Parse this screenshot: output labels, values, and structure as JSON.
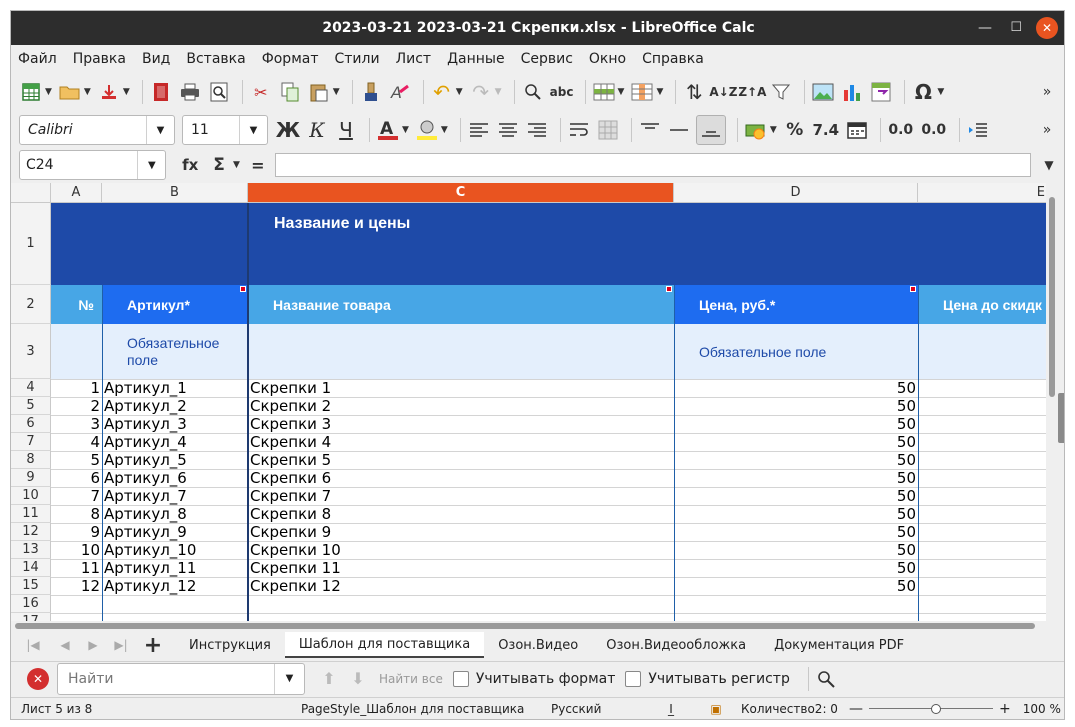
{
  "window": {
    "title": "2023-03-21 2023-03-21 Скрепки.xlsx - LibreOffice Calc"
  },
  "menu": [
    "Файл",
    "Правка",
    "Вид",
    "Вставка",
    "Формат",
    "Стили",
    "Лист",
    "Данные",
    "Сервис",
    "Окно",
    "Справка"
  ],
  "toolbar": {
    "font_name": "Calibri",
    "font_size": "11",
    "bold": "Ж",
    "italic": "К",
    "underline": "Ч",
    "currency_icon": "cash-icon",
    "percent": "%",
    "number_format": "7.4",
    "add_decimal": "0.0",
    "remove_decimal": "0.0"
  },
  "formula_bar": {
    "cell_ref": "C24",
    "fx": "fx",
    "sigma": "Σ",
    "equals": "=",
    "content": ""
  },
  "grid": {
    "columns": [
      "A",
      "B",
      "C",
      "D",
      "E"
    ],
    "active_column": "C",
    "row_numbers": [
      "1",
      "2",
      "3",
      "4",
      "5",
      "6",
      "7",
      "8",
      "9",
      "10",
      "11",
      "12",
      "13",
      "14",
      "15",
      "16",
      "17"
    ],
    "header_title": "Название и цены",
    "header_row": {
      "a": "№",
      "b": "Артикул*",
      "c": "Название товара",
      "d": "Цена, руб.*",
      "e": "Цена до скидк"
    },
    "hint_row": {
      "b": "Обязательное поле",
      "d": "Обязательное поле"
    },
    "rows": [
      {
        "n": "1",
        "sku": "Артикул_1",
        "name": "Скрепки 1",
        "price": "50"
      },
      {
        "n": "2",
        "sku": "Артикул_2",
        "name": "Скрепки 2",
        "price": "50"
      },
      {
        "n": "3",
        "sku": "Артикул_3",
        "name": "Скрепки 3",
        "price": "50"
      },
      {
        "n": "4",
        "sku": "Артикул_4",
        "name": "Скрепки 4",
        "price": "50"
      },
      {
        "n": "5",
        "sku": "Артикул_5",
        "name": "Скрепки 5",
        "price": "50"
      },
      {
        "n": "6",
        "sku": "Артикул_6",
        "name": "Скрепки 6",
        "price": "50"
      },
      {
        "n": "7",
        "sku": "Артикул_7",
        "name": "Скрепки 7",
        "price": "50"
      },
      {
        "n": "8",
        "sku": "Артикул_8",
        "name": "Скрепки 8",
        "price": "50"
      },
      {
        "n": "9",
        "sku": "Артикул_9",
        "name": "Скрепки 9",
        "price": "50"
      },
      {
        "n": "10",
        "sku": "Артикул_10",
        "name": "Скрепки 10",
        "price": "50"
      },
      {
        "n": "11",
        "sku": "Артикул_11",
        "name": "Скрепки 11",
        "price": "50"
      },
      {
        "n": "12",
        "sku": "Артикул_12",
        "name": "Скрепки 12",
        "price": "50"
      }
    ],
    "colors": {
      "title_bg": "#1e4aa8",
      "header_dark": "#1e6cf0",
      "header_light": "#47a6e6",
      "hint_bg": "#e4effc"
    }
  },
  "sheet_tabs": [
    "Инструкция",
    "Шаблон для поставщика",
    "Озон.Видео",
    "Озон.Видеообложка",
    "Документация PDF"
  ],
  "active_tab": "Шаблон для поставщика",
  "find": {
    "placeholder": "Найти",
    "find_all": "Найти все",
    "match_format": "Учитывать формат",
    "match_case": "Учитывать регистр"
  },
  "status": {
    "sheet": "Лист 5 из 8",
    "page_style": "PageStyle_Шаблон для поставщика",
    "language": "Русский",
    "count": "Количество2: 0",
    "zoom": "100 %"
  }
}
